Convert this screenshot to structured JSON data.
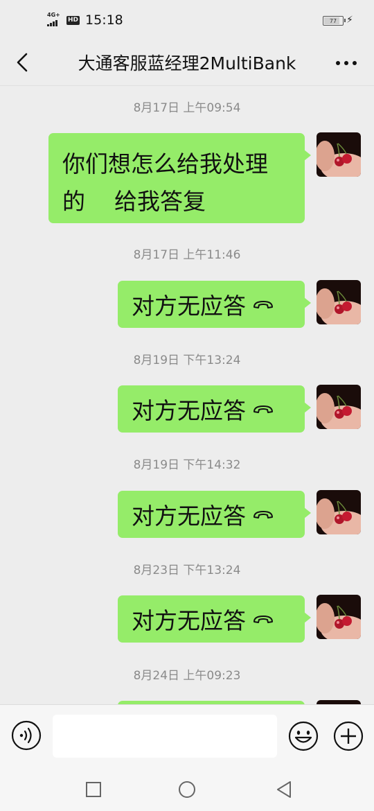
{
  "status_bar": {
    "network": "4G+",
    "hd": "HD",
    "time": "15:18",
    "battery_level": "77"
  },
  "header": {
    "title": "大通客服蓝经理2MultiBank"
  },
  "messages": [
    {
      "timestamp": "8月17日 上午09:54",
      "type": "text",
      "text": "你们想怎么给我处理\n的    给我答复"
    },
    {
      "timestamp": "8月17日 上午11:46",
      "type": "call",
      "text": "对方无应答"
    },
    {
      "timestamp": "8月19日 下午13:24",
      "type": "call",
      "text": "对方无应答"
    },
    {
      "timestamp": "8月19日 下午14:32",
      "type": "call",
      "text": "对方无应答"
    },
    {
      "timestamp": "8月23日 下午13:24",
      "type": "call",
      "text": "对方无应答"
    },
    {
      "timestamp": "8月24日 上午09:23",
      "type": "call",
      "text": ""
    }
  ],
  "input": {
    "value": "",
    "placeholder": ""
  },
  "colors": {
    "background": "#ededed",
    "bubble_sent": "#95ec69",
    "timestamp_text": "#8a8a8a"
  },
  "icons": {
    "back": "chevron-left-icon",
    "more": "more-dots-icon",
    "call": "phone-hangup-icon",
    "voice": "voice-icon",
    "emoji": "emoji-icon",
    "plus": "plus-icon"
  }
}
